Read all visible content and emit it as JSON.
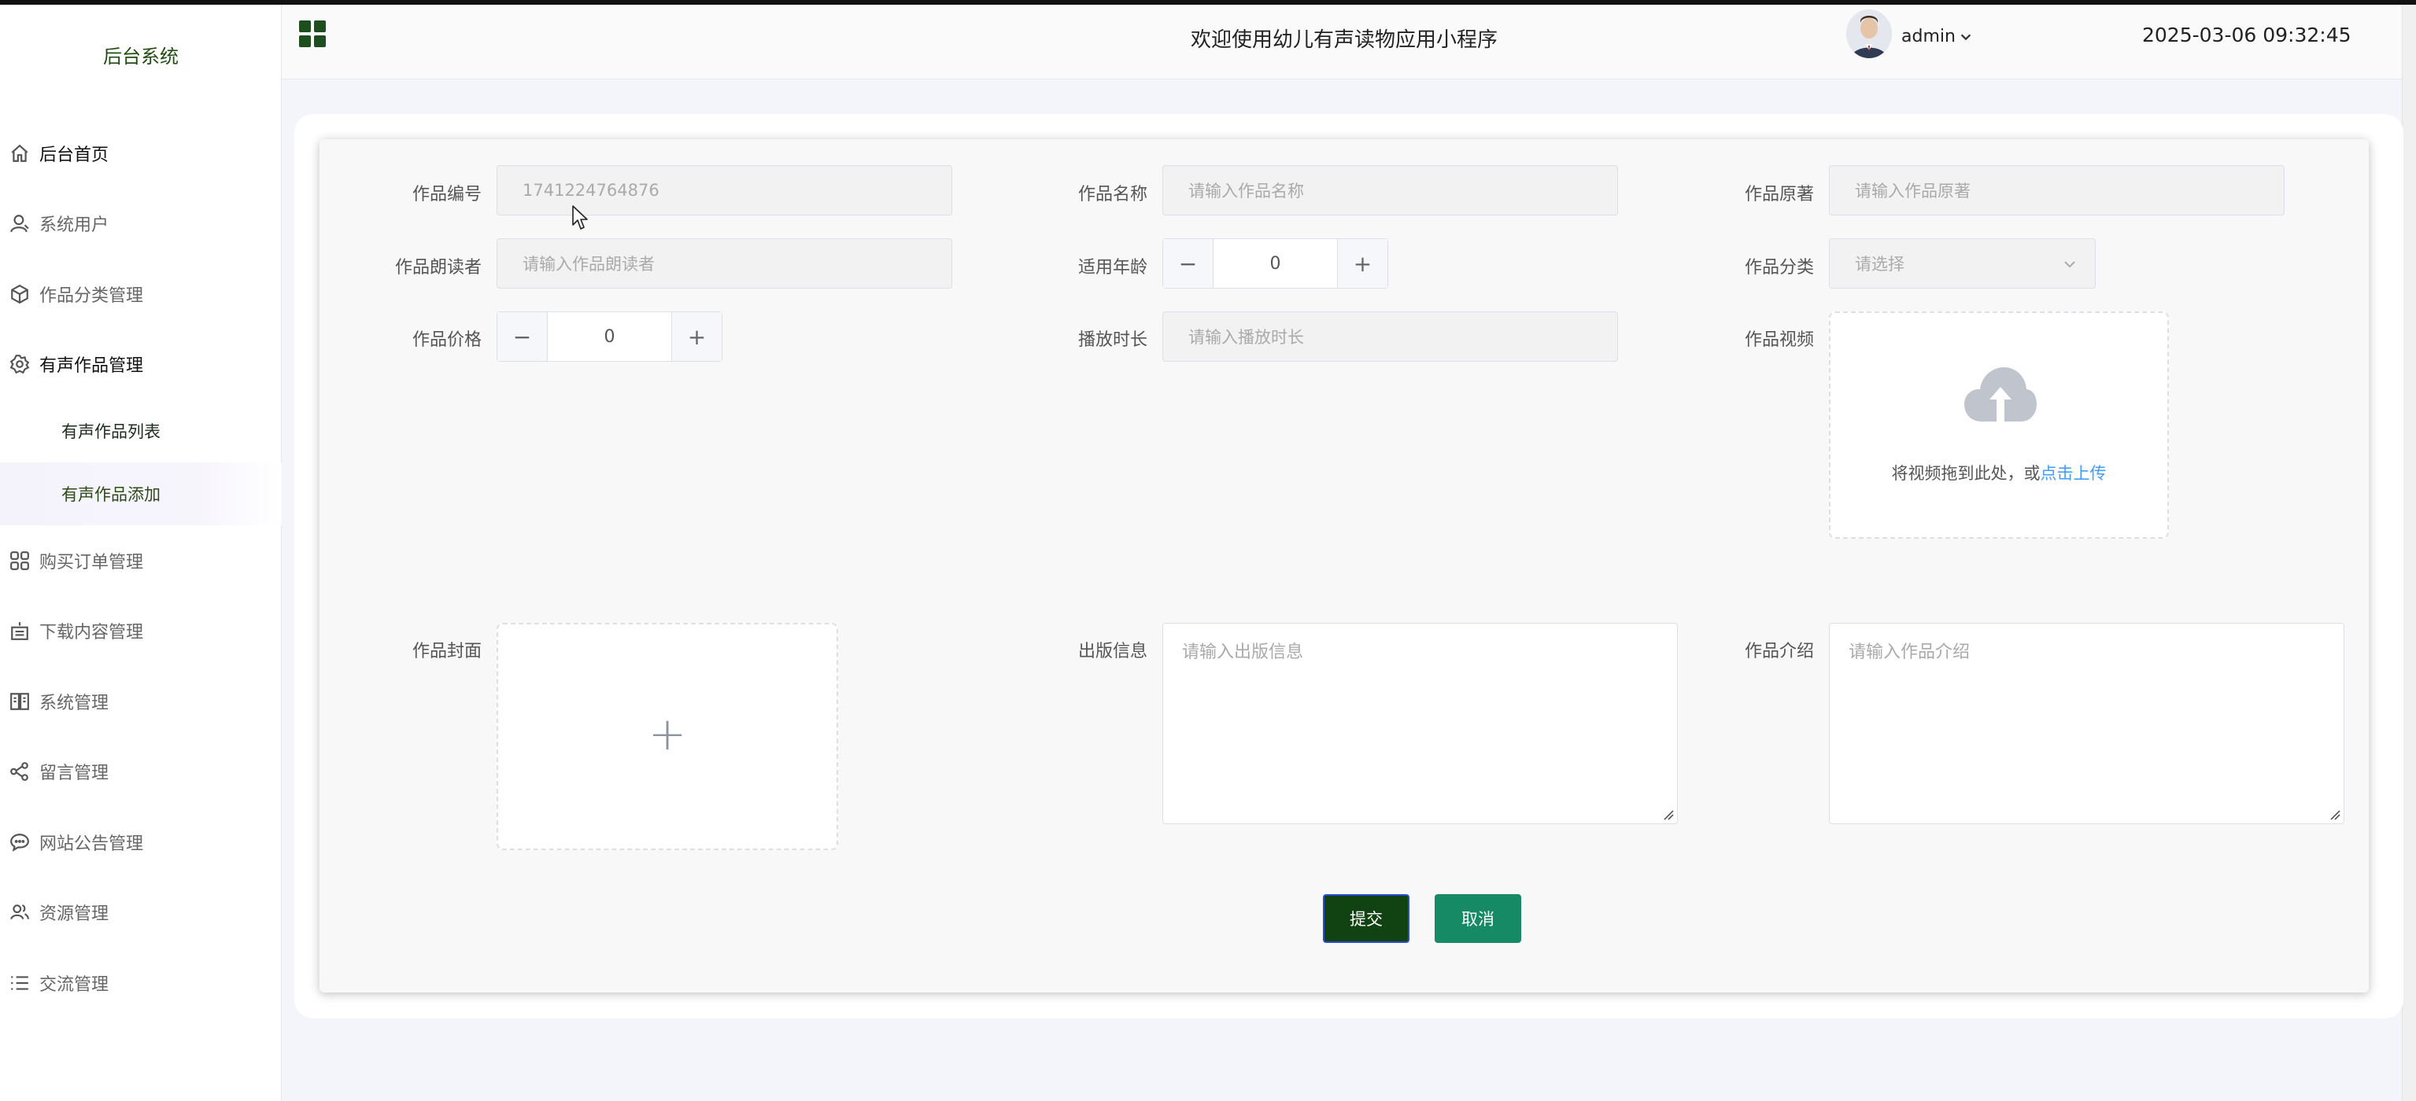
{
  "sidebar": {
    "brand": "后台系统",
    "items": [
      {
        "label": "后台首页",
        "icon": "home-icon"
      },
      {
        "label": "系统用户",
        "icon": "user-icon"
      },
      {
        "label": "作品分类管理",
        "icon": "cube-icon"
      },
      {
        "label": "有声作品管理",
        "icon": "gear-icon"
      },
      {
        "label": "购买订单管理",
        "icon": "grid-icon"
      },
      {
        "label": "下载内容管理",
        "icon": "box-icon"
      },
      {
        "label": "系统管理",
        "icon": "book-icon"
      },
      {
        "label": "留言管理",
        "icon": "share-icon"
      },
      {
        "label": "网站公告管理",
        "icon": "chat-icon"
      },
      {
        "label": "资源管理",
        "icon": "users-icon"
      },
      {
        "label": "交流管理",
        "icon": "list-icon"
      }
    ],
    "submenu": [
      {
        "label": "有声作品列表"
      },
      {
        "label": "有声作品添加"
      }
    ]
  },
  "header": {
    "title": "欢迎使用幼儿有声读物应用小程序",
    "username": "admin",
    "datetime": "2025-03-06 09:32:45"
  },
  "form": {
    "code": {
      "label": "作品编号",
      "value": "1741224764876"
    },
    "name": {
      "label": "作品名称",
      "placeholder": "请输入作品名称"
    },
    "author": {
      "label": "作品原著",
      "placeholder": "请输入作品原著"
    },
    "reader": {
      "label": "作品朗读者",
      "placeholder": "请输入作品朗读者"
    },
    "age": {
      "label": "适用年龄",
      "value": "0",
      "minus": "−",
      "plus": "+"
    },
    "category": {
      "label": "作品分类",
      "placeholder": "请选择"
    },
    "price": {
      "label": "作品价格",
      "value": "0",
      "minus": "−",
      "plus": "+"
    },
    "duration": {
      "label": "播放时长",
      "placeholder": "请输入播放时长"
    },
    "video": {
      "label": "作品视频",
      "hint": "将视频拖到此处，或",
      "link": "点击上传"
    },
    "cover": {
      "label": "作品封面",
      "plus": "+"
    },
    "publish": {
      "label": "出版信息",
      "placeholder": "请输入出版信息"
    },
    "intro": {
      "label": "作品介绍",
      "placeholder": "请输入作品介绍"
    }
  },
  "actions": {
    "submit": "提交",
    "cancel": "取消"
  },
  "colors": {
    "accent": "#114211",
    "cancel": "#168a64",
    "link": "#409eff"
  }
}
